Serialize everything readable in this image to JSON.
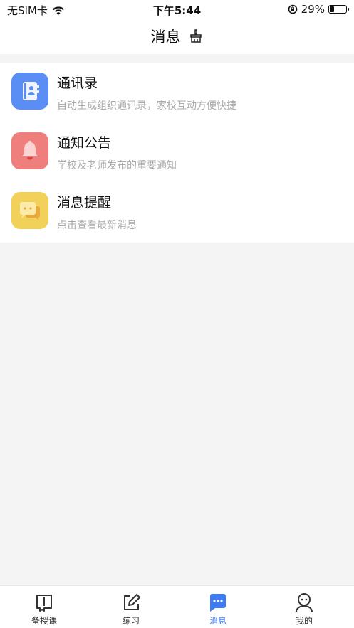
{
  "status_bar": {
    "carrier": "无SIM卡",
    "time": "下午5:44",
    "battery": "29%"
  },
  "header": {
    "title": "消息"
  },
  "items": [
    {
      "title": "通讯录",
      "subtitle": "自动生成组织通讯录，家校互动方便快捷",
      "icon": "contacts-book-icon",
      "color": "#5b8ef5"
    },
    {
      "title": "通知公告",
      "subtitle": "学校及老师发布的重要通知",
      "icon": "bell-icon",
      "color": "#ee7f7c"
    },
    {
      "title": "消息提醒",
      "subtitle": "点击查看最新消息",
      "icon": "chat-bubble-icon",
      "color": "#f1d15a"
    }
  ],
  "tabbar": {
    "tabs": [
      {
        "label": "备授课",
        "icon": "book-icon"
      },
      {
        "label": "练习",
        "icon": "edit-icon"
      },
      {
        "label": "消息",
        "icon": "message-icon",
        "active": true
      },
      {
        "label": "我的",
        "icon": "profile-icon"
      }
    ],
    "active_color": "#3d7cf2"
  }
}
